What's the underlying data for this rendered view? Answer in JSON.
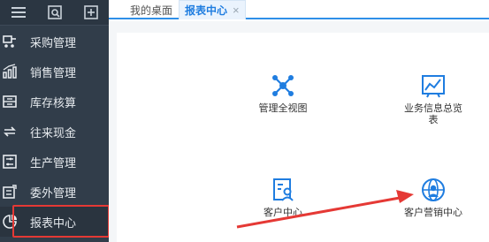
{
  "colors": {
    "sidebar_bg": "#313d4a",
    "accent": "#2f8fe8",
    "highlight": "#e53935"
  },
  "sidebar": {
    "top_icons": [
      "menu-icon",
      "search-doc-icon",
      "add-doc-icon"
    ],
    "items": [
      {
        "label": "采购管理",
        "icon": "purchase-icon"
      },
      {
        "label": "销售管理",
        "icon": "sales-chart-icon"
      },
      {
        "label": "库存核算",
        "icon": "inventory-icon"
      },
      {
        "label": "往来现金",
        "icon": "exchange-icon"
      },
      {
        "label": "生产管理",
        "icon": "production-icon"
      },
      {
        "label": "委外管理",
        "icon": "outsource-icon"
      },
      {
        "label": "报表中心",
        "icon": "report-icon",
        "active": true
      }
    ]
  },
  "tabs": [
    {
      "label": "我的桌面"
    },
    {
      "label": "报表中心",
      "active": true,
      "close": "×"
    }
  ],
  "tiles": [
    {
      "label": "管理全视图",
      "icon": "network-icon"
    },
    {
      "label": "业务信息总览表",
      "icon": "chart-board-icon"
    },
    {
      "label": "客户中心",
      "icon": "customer-doc-icon"
    },
    {
      "label": "客户营销中心",
      "icon": "globe-user-icon"
    }
  ]
}
